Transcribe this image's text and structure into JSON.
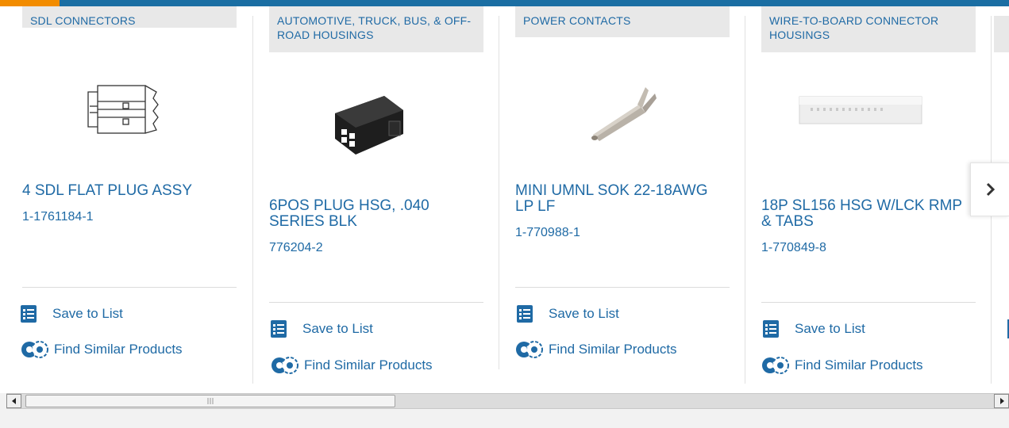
{
  "cards": [
    {
      "category": "SDL CONNECTORS",
      "name": "4 SDL FLAT PLUG ASSY",
      "part_number": "1-1761184-1",
      "save_label": "Save to List",
      "similar_label": "Find Similar Products",
      "image_icon": "sdl-flat-plug-line-drawing"
    },
    {
      "category": "AUTOMOTIVE, TRUCK, BUS, & OFF-ROAD HOUSINGS",
      "name": "6POS PLUG HSG, .040 SERIES BLK",
      "part_number": "776204-2",
      "save_label": "Save to List",
      "similar_label": "Find Similar Products",
      "image_icon": "black-plug-housing"
    },
    {
      "category": "POWER CONTACTS",
      "name": "MINI UMNL SOK 22-18AWG LP LF",
      "part_number": "1-770988-1",
      "save_label": "Save to List",
      "similar_label": "Find Similar Products",
      "image_icon": "socket-contact"
    },
    {
      "category": "WIRE-TO-BOARD CONNECTOR HOUSINGS",
      "name": "18P SL156 HSG W/LCK RMP & TABS",
      "part_number": "1-770849-8",
      "save_label": "Save to List",
      "similar_label": "Find Similar Products",
      "image_icon": "white-connector-housing"
    }
  ],
  "colors": {
    "link": "#1f6aa5",
    "brand_bar": "#1a6ea3",
    "accent": "#f28c00",
    "category_bg": "#e8e8e8"
  },
  "icons": {
    "next": "chevron-right-icon",
    "save": "checklist-icon",
    "similar": "similar-gears-icon"
  }
}
